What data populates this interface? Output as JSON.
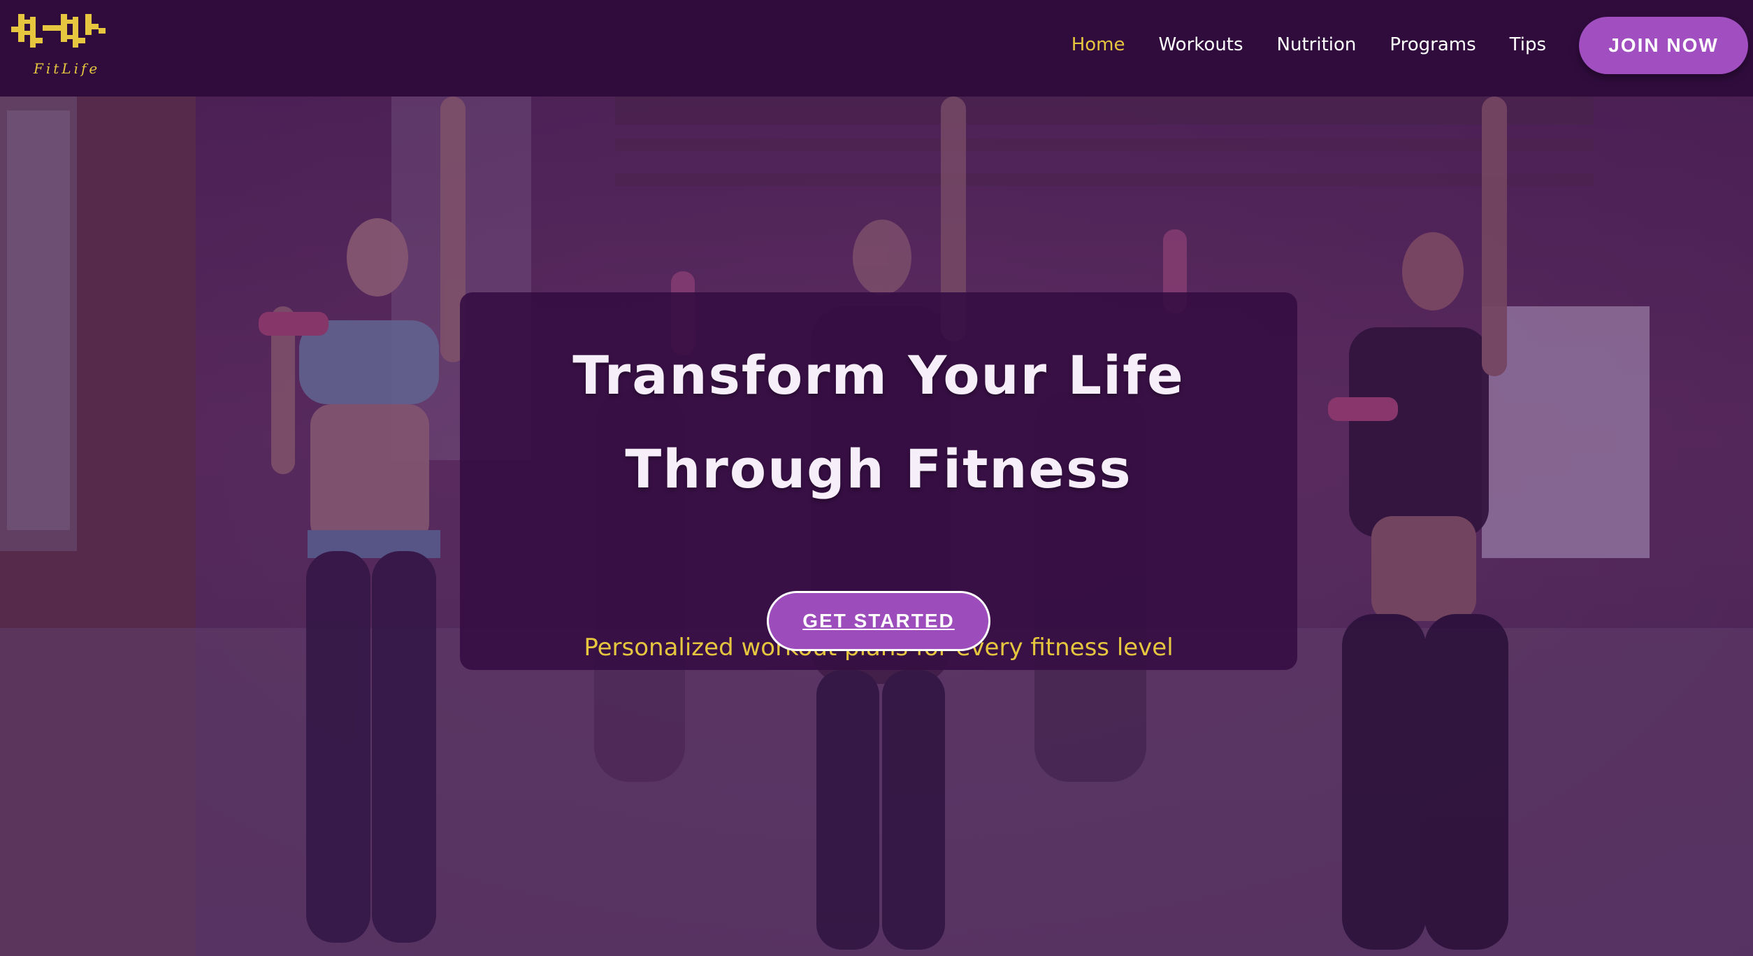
{
  "brand": {
    "name": "FitLife",
    "logo_icon": "fitlife-logo-icon"
  },
  "nav": {
    "items": [
      {
        "label": "Home",
        "active": true
      },
      {
        "label": "Workouts",
        "active": false
      },
      {
        "label": "Nutrition",
        "active": false
      },
      {
        "label": "Programs",
        "active": false
      },
      {
        "label": "Tips",
        "active": false
      }
    ],
    "join_label": "JOIN NOW"
  },
  "hero": {
    "title_line1": "Transform Your Life",
    "title_line2": "Through Fitness",
    "subtitle": "Personalized workout plans for every fitness level",
    "cta_label": "GET STARTED",
    "background_image": "women-dumbbell-fitness-class-photo"
  },
  "colors": {
    "navbar_bg": "#300c3d",
    "accent_gold": "#e6c63f",
    "button_purple": "#a04ec0",
    "card_bg": "#340c42"
  }
}
